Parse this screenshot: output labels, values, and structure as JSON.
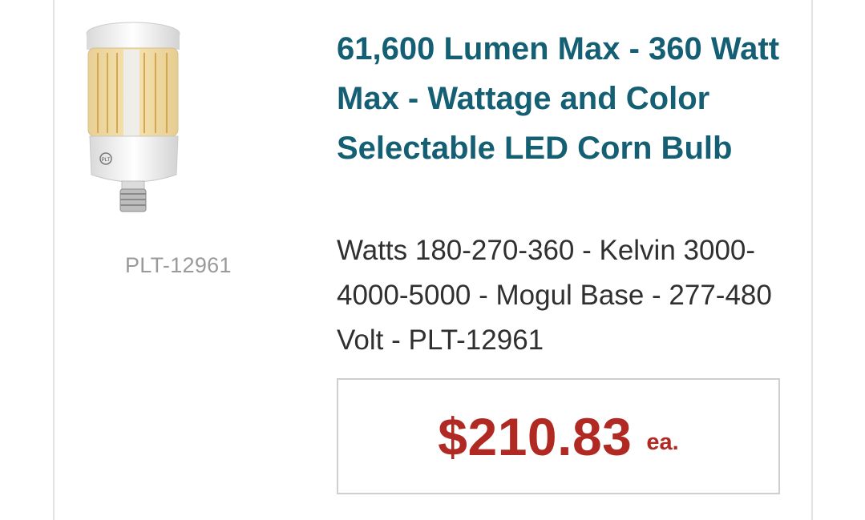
{
  "product": {
    "image_icon": "led-corn-bulb-icon",
    "logo_text": "PLT",
    "sku": "PLT-12961",
    "title": "61,600 Lumen Max - 360 Watt Max - Wattage and Color Selectable LED Corn Bulb",
    "description": "Watts 180-270-360 - Kelvin 3000-4000-5000 - Mogul Base - 277-480 Volt - PLT-12961",
    "price": "$210.83",
    "price_unit": "ea."
  },
  "colors": {
    "title": "#155f74",
    "price": "#b02a23",
    "sku": "#9a9a9a",
    "text": "#303030"
  }
}
